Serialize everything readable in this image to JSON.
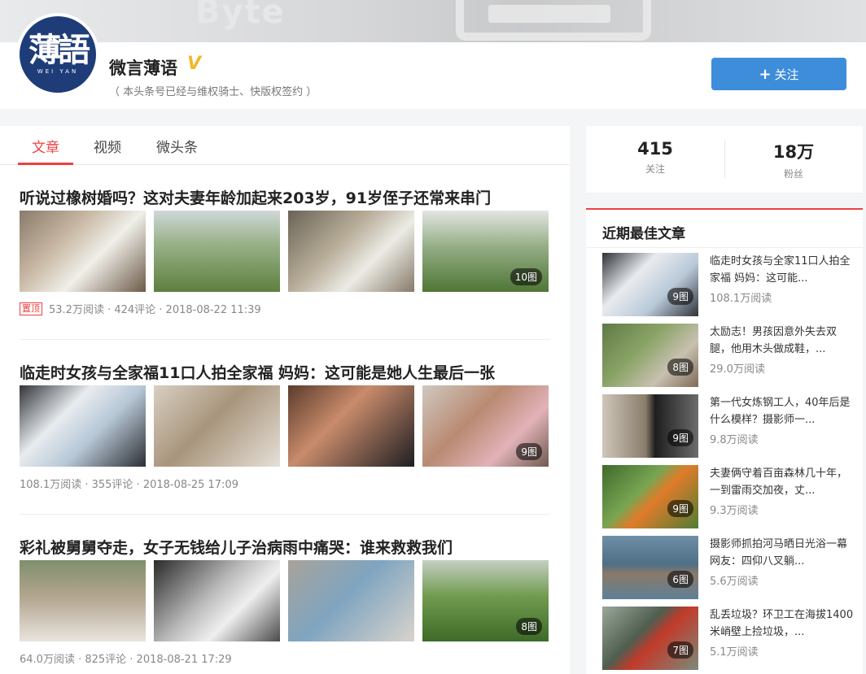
{
  "profile": {
    "name": "微言薄语",
    "verified_mark": "V",
    "info": "（ 本头条号已经与维权骑士、快版权签约 ）",
    "avatar_main": "薄語",
    "avatar_sub": "WEI YAN",
    "follow_label": "关注",
    "banner_text": "Byte"
  },
  "tabs": [
    "文章",
    "视频",
    "微头条"
  ],
  "articles": [
    {
      "title": "听说过橡树婚吗？这对夫妻年龄加起来203岁，91岁侄子还常来串门",
      "pinned_label": "置顶",
      "meta": "53.2万阅读 · 424评论 · 2018-08-22 11:39",
      "image_count": "10图"
    },
    {
      "title": "临走时女孩与全家福11口人拍全家福 妈妈：这可能是她人生最后一张",
      "meta": "108.1万阅读 · 355评论 · 2018-08-25 17:09",
      "image_count": "9图"
    },
    {
      "title": "彩礼被舅舅夺走，女子无钱给儿子治病雨中痛哭：谁来救救我们",
      "meta": "64.0万阅读 · 825评论 · 2018-08-21 17:29",
      "image_count": "8图"
    }
  ],
  "stats": [
    {
      "value": "415",
      "label": "关注"
    },
    {
      "value": "18万",
      "label": "粉丝"
    }
  ],
  "best": {
    "title": "近期最佳文章",
    "items": [
      {
        "title": "临走时女孩与全家11口人拍全家福 妈妈：这可能...",
        "reads": "108.1万阅读",
        "count": "9图"
      },
      {
        "title": "太励志！男孩因意外失去双腿，他用木头做成鞋，...",
        "reads": "29.0万阅读",
        "count": "8图"
      },
      {
        "title": "第一代女炼钢工人，40年后是什么模样？摄影师一...",
        "reads": "9.8万阅读",
        "count": "9图"
      },
      {
        "title": "夫妻俩守着百亩森林几十年，一到雷雨交加夜，丈...",
        "reads": "9.3万阅读",
        "count": "9图"
      },
      {
        "title": "摄影师抓拍河马晒日光浴一幕 网友：四仰八叉躺...",
        "reads": "5.6万阅读",
        "count": "6图"
      },
      {
        "title": "乱丢垃圾？环卫工在海拔1400米峭壁上捡垃圾，...",
        "reads": "5.1万阅读",
        "count": "7图"
      }
    ]
  },
  "colors": {
    "accent": "#ed4040",
    "follow_button": "#3d8ddb",
    "verified": "#f3b62b",
    "avatar_bg": "#1e3c78"
  }
}
